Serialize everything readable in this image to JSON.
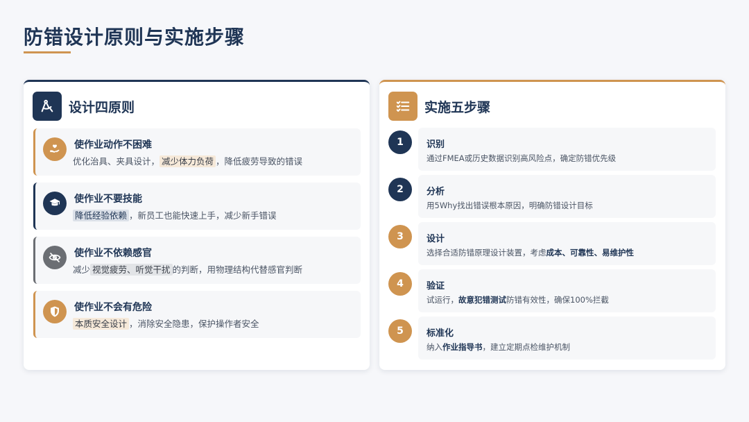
{
  "page": {
    "title": "防错设计原则与实施步骤"
  },
  "colors": {
    "navy": "#1f3555",
    "gold": "#cf9450",
    "gray": "#6b6e73"
  },
  "left_card": {
    "title": "设计四原则",
    "icon": "drafting-compass-icon",
    "principles": [
      {
        "icon": "hand-heart-icon",
        "title": "使作业动作不困难",
        "desc_pre": "优化治具、夹具设计，",
        "desc_highlight": "减少体力负荷",
        "desc_post": "，降低疲劳导致的错误"
      },
      {
        "icon": "graduation-cap-icon",
        "title": "使作业不要技能",
        "desc_pre": "",
        "desc_highlight": "降低经验依赖",
        "desc_post": "，新员工也能快速上手，减少新手错误"
      },
      {
        "icon": "eye-slash-icon",
        "title": "使作业不依赖感官",
        "desc_pre": "减少",
        "desc_highlight": "视觉疲劳、听觉干扰",
        "desc_post": "的判断，用物理结构代替感官判断"
      },
      {
        "icon": "shield-icon",
        "title": "使作业不会有危险",
        "desc_pre": "",
        "desc_highlight": "本质安全设计",
        "desc_post": "，消除安全隐患，保护操作者安全"
      }
    ]
  },
  "right_card": {
    "title": "实施五步骤",
    "icon": "list-check-icon",
    "steps": [
      {
        "num": "1",
        "title": "识别",
        "desc_a": "通过FMEA或历史数据识别高风险点，确定防错优先级",
        "bold_b": "",
        "desc_c": "",
        "bold_d": "",
        "desc_e": ""
      },
      {
        "num": "2",
        "title": "分析",
        "desc_a": "用5Why找出错误根本原因，明确防错设计目标",
        "bold_b": "",
        "desc_c": "",
        "bold_d": "",
        "desc_e": ""
      },
      {
        "num": "3",
        "title": "设计",
        "desc_a": "选择合适防错原理设计装置，考虑",
        "bold_b": "成本、可靠性、易维护性",
        "desc_c": "",
        "bold_d": "",
        "desc_e": ""
      },
      {
        "num": "4",
        "title": "验证",
        "desc_a": "试运行，",
        "bold_b": "故意犯错测试",
        "desc_c": "防错有效性，确保100%拦截",
        "bold_d": "",
        "desc_e": ""
      },
      {
        "num": "5",
        "title": "标准化",
        "desc_a": "纳入",
        "bold_b": "作业指导书",
        "desc_c": "，建立定期点检维护机制",
        "bold_d": "",
        "desc_e": ""
      }
    ]
  }
}
